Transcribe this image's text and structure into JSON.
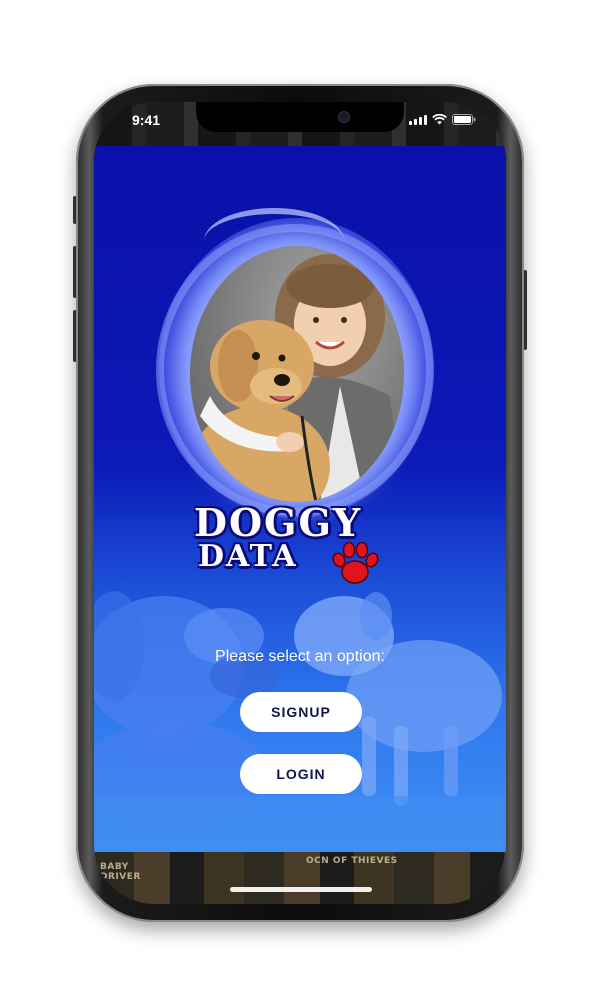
{
  "status_bar": {
    "time": "9:41"
  },
  "app": {
    "logo_line1": "DOGGY",
    "logo_line2": "DATA",
    "prompt": "Please select an option:",
    "signup_label": "SIGNUP",
    "login_label": "LOGIN"
  },
  "background_strip": {
    "text1": "BABY DRIVER",
    "text2": "OCN OF THIEVES"
  },
  "colors": {
    "brand_blue": "#0c1ab8",
    "paw_red": "#e0141e",
    "button_bg": "#ffffff"
  },
  "icons": [
    "wifi-icon",
    "signal-icon",
    "battery-icon",
    "paw-icon"
  ]
}
